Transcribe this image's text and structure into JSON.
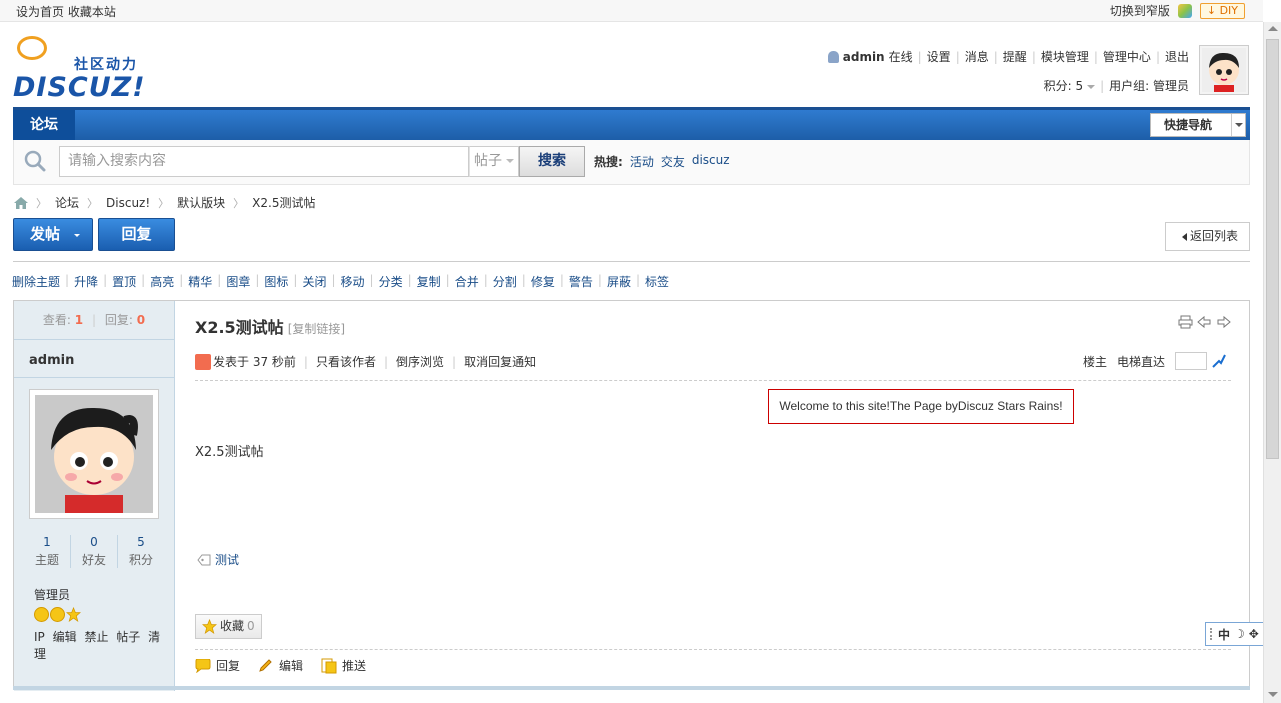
{
  "topbar": {
    "set_home": "设为首页",
    "bookmark": "收藏本站",
    "switch_width": "切换到窄版",
    "diy": "DIY"
  },
  "logo": {
    "brand": "DISCUZ!",
    "slogan": "社区动力"
  },
  "user": {
    "name": "admin",
    "status": "在线",
    "links": [
      "设置",
      "消息",
      "提醒",
      "模块管理",
      "管理中心",
      "退出"
    ],
    "points_label": "积分: 5",
    "group_label": "用户组: 管理员"
  },
  "nav": {
    "tab": "论坛",
    "quick": "快捷导航"
  },
  "search": {
    "placeholder": "请输入搜索内容",
    "type": "帖子",
    "button": "搜索",
    "hot_label": "热搜:",
    "hot": [
      "活动",
      "交友",
      "discuz"
    ]
  },
  "breadcrumb": [
    "论坛",
    "Discuz!",
    "默认版块",
    "X2.5测试帖"
  ],
  "actions": {
    "post": "发帖",
    "reply": "回复",
    "back": "返回列表"
  },
  "modbar": [
    "删除主题",
    "升降",
    "置顶",
    "高亮",
    "精华",
    "图章",
    "图标",
    "关闭",
    "移动",
    "分类",
    "复制",
    "合并",
    "分割",
    "修复",
    "警告",
    "屏蔽",
    "标签"
  ],
  "thread": {
    "views_label": "查看:",
    "views": "1",
    "replies_label": "回复:",
    "replies": "0",
    "title": "X2.5测试帖",
    "copy_link": "[复制链接]",
    "posted": "发表于 37 秒前",
    "only_author": "只看该作者",
    "reverse": "倒序浏览",
    "cancel_notify": "取消回复通知",
    "floor": "楼主",
    "jump": "电梯直达",
    "welcome": "Welcome to this site!The Page byDiscuz Stars Rains!",
    "body": "X2.5测试帖",
    "tag": "测试",
    "fav_label": "收藏",
    "fav_count": "0",
    "post_actions": [
      "回复",
      "编辑",
      "推送"
    ]
  },
  "author": {
    "name": "admin",
    "counts": [
      {
        "n": "1",
        "l": "主题"
      },
      {
        "n": "0",
        "l": "好友"
      },
      {
        "n": "5",
        "l": "积分"
      }
    ],
    "group": "管理员",
    "mod_links": [
      "IP",
      "编辑",
      "禁止",
      "帖子",
      "清理"
    ]
  },
  "ime": {
    "lang": "中"
  }
}
